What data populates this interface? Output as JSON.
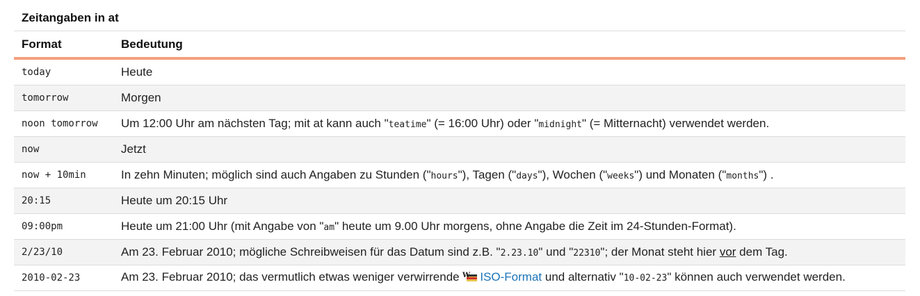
{
  "caption": "Zeitangaben in at",
  "headers": {
    "format": "Format",
    "meaning": "Bedeutung"
  },
  "rows": [
    {
      "format": "today",
      "meaning": "Heute"
    },
    {
      "format": "tomorrow",
      "meaning": "Morgen"
    },
    {
      "format": "noon tomorrow",
      "meaning_parts": [
        "Um 12:00 Uhr am nächsten Tag; mit at kann auch \"",
        "teatime",
        "\" (= 16:00 Uhr) oder \"",
        "midnight",
        "\" (= Mitternacht) verwendet werden."
      ]
    },
    {
      "format": "now",
      "meaning": "Jetzt"
    },
    {
      "format": "now + 10min",
      "meaning_parts": [
        "In zehn Minuten; möglich sind auch Angaben zu Stunden (\"",
        "hours",
        "\"), Tagen (\"",
        "days",
        "\"), Wochen (\"",
        "weeks",
        "\") und Monaten (\"",
        "months",
        "\") ."
      ]
    },
    {
      "format": "20:15",
      "meaning": "Heute um 20:15 Uhr"
    },
    {
      "format": "09:00pm",
      "meaning_parts": [
        "Heute um 21:00 Uhr (mit Angabe von \"",
        "am",
        "\" heute um 9.00 Uhr morgens, ohne Angabe die Zeit im 24-Stunden-Format)."
      ]
    },
    {
      "format": "2/23/10",
      "meaning_parts": [
        "Am 23. Februar 2010; mögliche Schreibweisen für das Datum sind z.B. \"",
        "2.23.10",
        "\" und \"",
        "22310",
        "\"; der Monat steht hier ",
        "vor",
        " dem Tag."
      ]
    },
    {
      "format": "2010-02-23",
      "meaning_parts": [
        "Am 23. Februar 2010; das vermutlich etwas weniger verwirrende ",
        "ISO-Format",
        " und alternativ \"",
        "10-02-23",
        "\" können auch verwendet werden."
      ],
      "link_icon": "wikipedia-icon"
    }
  ]
}
